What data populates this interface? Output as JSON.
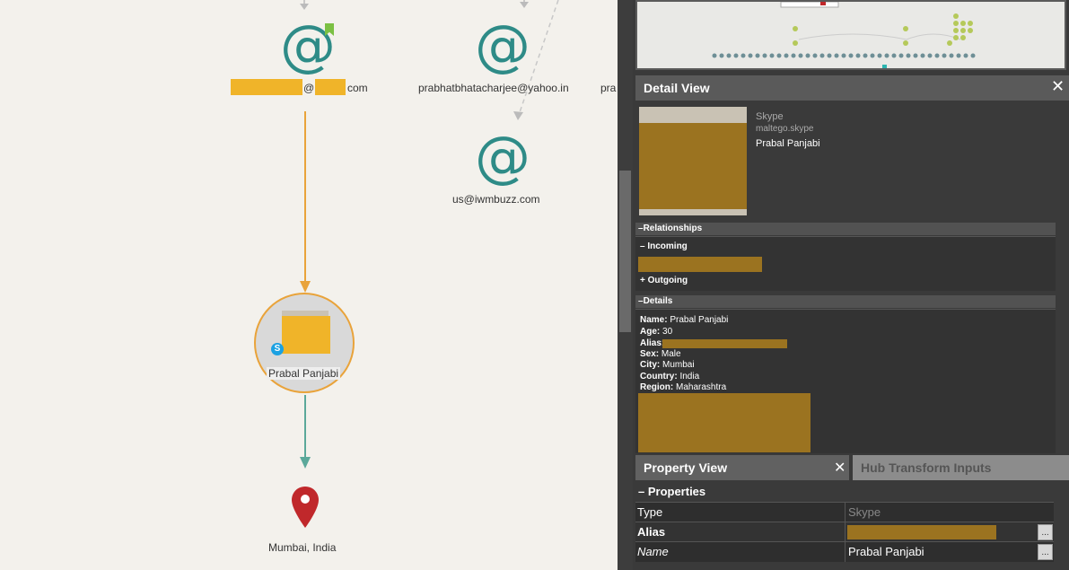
{
  "graph": {
    "email_nodes": [
      {
        "label_suffix": "com",
        "at_symbol": "@"
      },
      {
        "label": "prabhatbhatacharjee@yahoo.in",
        "at_symbol": "@"
      },
      {
        "label": "us@iwmbuzz.com",
        "at_symbol": "@"
      },
      {
        "label": "pra"
      }
    ],
    "skype_node": {
      "label": "Prabal Panjabi",
      "badge": "S"
    },
    "location_node": {
      "label": "Mumbai, India"
    },
    "icons": [
      "email-icon",
      "bookmark-flag-icon",
      "skype-icon",
      "map-pin-icon"
    ],
    "colors": {
      "email": "#2e8b87",
      "edge_in": "#e9a33a",
      "edge_out": "#5ba89a",
      "pin": "#c0282b",
      "redaction": "#f0b429"
    }
  },
  "detail_view": {
    "title": "Detail View",
    "entity_type": "Skype",
    "entity_type_id": "maltego.skype",
    "entity_name": "Prabal Panjabi",
    "sections": {
      "relationships": "Relationships",
      "incoming": "Incoming",
      "outgoing": "+ Outgoing",
      "details": "Details"
    },
    "details": [
      {
        "key": "Name:",
        "value": "Prabal Panjabi"
      },
      {
        "key": "Age:",
        "value": "30"
      },
      {
        "key": "Alias:",
        "value": ""
      },
      {
        "key": "Sex:",
        "value": "Male"
      },
      {
        "key": "City:",
        "value": "Mumbai"
      },
      {
        "key": "Country:",
        "value": "India"
      },
      {
        "key": "Region:",
        "value": "Maharashtra"
      }
    ]
  },
  "property_view": {
    "title": "Property View",
    "hub_tab": "Hub Transform Inputs",
    "section": "Properties",
    "rows": [
      {
        "key": "Type",
        "value": "Skype"
      },
      {
        "key": "Alias",
        "value": ""
      },
      {
        "key": "Name",
        "value": "Prabal Panjabi"
      }
    ],
    "more_button": "..."
  }
}
